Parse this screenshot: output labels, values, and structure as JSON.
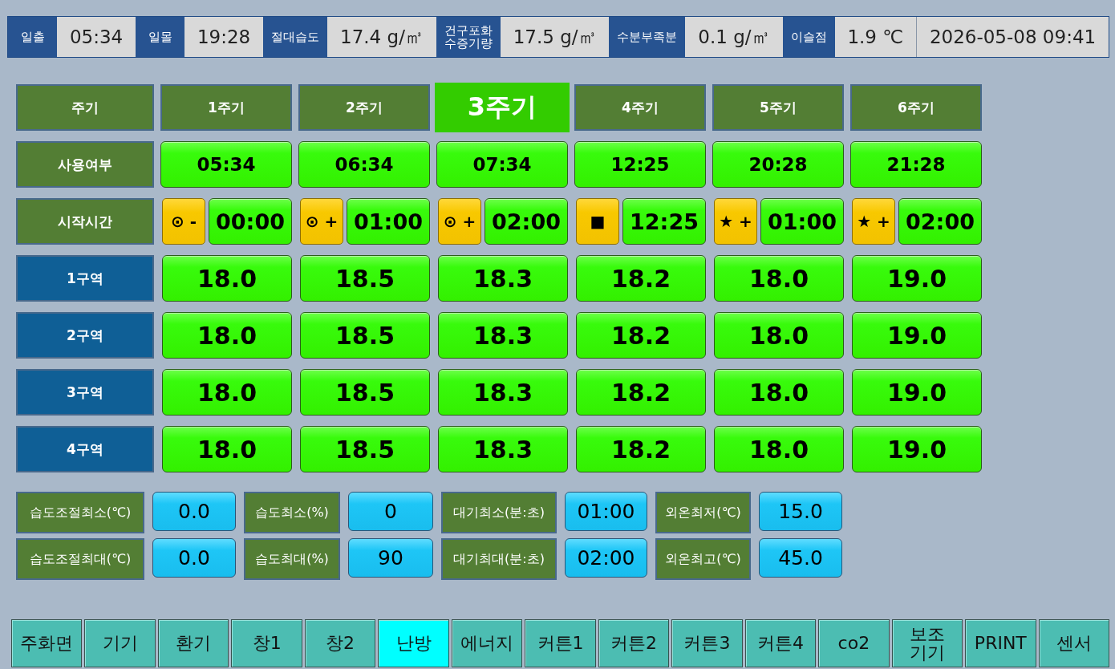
{
  "status_bar": {
    "readings": [
      {
        "label": "일출",
        "value": "05:34"
      },
      {
        "label": "일몰",
        "value": "19:28"
      },
      {
        "label": "절대습도",
        "value": "17.4 g/㎥"
      },
      {
        "label": "건구포화\n수증기량",
        "value": "17.5 g/㎥"
      },
      {
        "label": "수분부족분",
        "value": "0.1 g/㎥"
      },
      {
        "label": "이슬점",
        "value": "1.9 ℃"
      }
    ],
    "datetime": "2026-05-08 09:41"
  },
  "schedule": {
    "corner_label": "주기",
    "periods": [
      {
        "label": "1주기",
        "selected": false
      },
      {
        "label": "2주기",
        "selected": false
      },
      {
        "label": "3주기",
        "selected": true
      },
      {
        "label": "4주기",
        "selected": false
      },
      {
        "label": "5주기",
        "selected": false
      },
      {
        "label": "6주기",
        "selected": false
      }
    ],
    "rows": [
      {
        "kind": "time",
        "label": "사용여부",
        "cells": [
          {
            "value": "05:34"
          },
          {
            "value": "06:34"
          },
          {
            "value": "07:34"
          },
          {
            "value": "12:25"
          },
          {
            "value": "20:28"
          },
          {
            "value": "21:28"
          }
        ]
      },
      {
        "kind": "start",
        "label": "시작시간",
        "cells": [
          {
            "mode": "⊙ -",
            "value": "00:00"
          },
          {
            "mode": "⊙ +",
            "value": "01:00"
          },
          {
            "mode": "⊙ +",
            "value": "02:00"
          },
          {
            "mode": "■",
            "value": "12:25"
          },
          {
            "mode": "★ +",
            "value": "01:00"
          },
          {
            "mode": "★ +",
            "value": "02:00"
          }
        ]
      },
      {
        "kind": "zone",
        "label": "1구역",
        "cells": [
          {
            "value": "18.0"
          },
          {
            "value": "18.5"
          },
          {
            "value": "18.3"
          },
          {
            "value": "18.2"
          },
          {
            "value": "18.0"
          },
          {
            "value": "19.0"
          }
        ]
      },
      {
        "kind": "zone",
        "label": "2구역",
        "cells": [
          {
            "value": "18.0"
          },
          {
            "value": "18.5"
          },
          {
            "value": "18.3"
          },
          {
            "value": "18.2"
          },
          {
            "value": "18.0"
          },
          {
            "value": "19.0"
          }
        ]
      },
      {
        "kind": "zone",
        "label": "3구역",
        "cells": [
          {
            "value": "18.0"
          },
          {
            "value": "18.5"
          },
          {
            "value": "18.3"
          },
          {
            "value": "18.2"
          },
          {
            "value": "18.0"
          },
          {
            "value": "19.0"
          }
        ]
      },
      {
        "kind": "zone",
        "label": "4구역",
        "cells": [
          {
            "value": "18.0"
          },
          {
            "value": "18.5"
          },
          {
            "value": "18.3"
          },
          {
            "value": "18.2"
          },
          {
            "value": "18.0"
          },
          {
            "value": "19.0"
          }
        ]
      }
    ]
  },
  "settings": {
    "rows": [
      {
        "items": [
          {
            "label": "습도조절최소(℃)",
            "value": "0.0"
          },
          {
            "label": "습도최소(%)",
            "value": "0"
          },
          {
            "label": "대기최소(분:초)",
            "value": "01:00"
          },
          {
            "label": "외온최저(℃)",
            "value": "15.0"
          }
        ]
      },
      {
        "items": [
          {
            "label": "습도조절최대(℃)",
            "value": "0.0"
          },
          {
            "label": "습도최대(%)",
            "value": "90"
          },
          {
            "label": "대기최대(분:초)",
            "value": "02:00"
          },
          {
            "label": "외온최고(℃)",
            "value": "45.0"
          }
        ]
      }
    ]
  },
  "nav": [
    {
      "label": "주화면",
      "selected": false
    },
    {
      "label": "기기",
      "selected": false
    },
    {
      "label": "환기",
      "selected": false
    },
    {
      "label": "창1",
      "selected": false
    },
    {
      "label": "창2",
      "selected": false
    },
    {
      "label": "난방",
      "selected": true
    },
    {
      "label": "에너지",
      "selected": false
    },
    {
      "label": "커튼1",
      "selected": false
    },
    {
      "label": "커튼2",
      "selected": false
    },
    {
      "label": "커튼3",
      "selected": false
    },
    {
      "label": "커튼4",
      "selected": false
    },
    {
      "label": "co2",
      "selected": false
    },
    {
      "label": "보조\n기기",
      "selected": false
    },
    {
      "label": "PRINT",
      "selected": false
    },
    {
      "label": "센서",
      "selected": false
    }
  ]
}
